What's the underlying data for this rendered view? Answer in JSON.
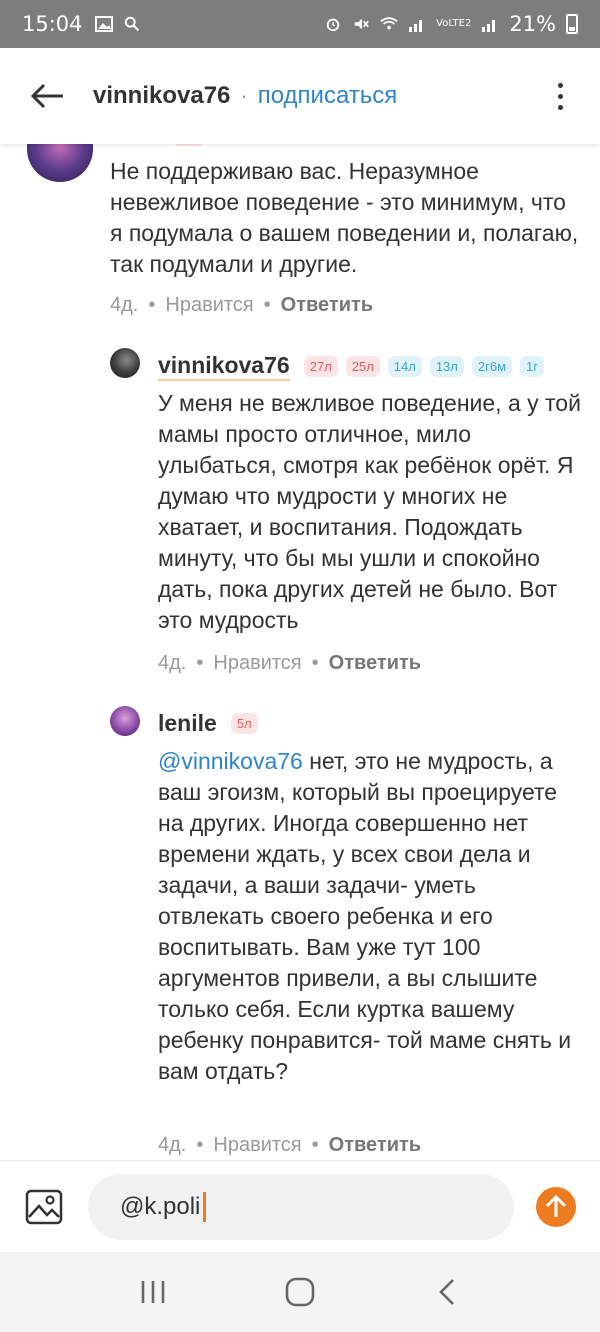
{
  "status_bar": {
    "time": "15:04",
    "battery": "21%",
    "network": "VoLTE2"
  },
  "header": {
    "username": "vinnikova76",
    "separator": "·",
    "subscribe_label": "подписаться"
  },
  "comments": [
    {
      "text": "Не поддерживаю вас. Неразумное невежливое поведение - это минимум, что я подумала о вашем поведении и, полагаю, так подумали и другие.",
      "time": "4д.",
      "like_label": "Нравится",
      "reply_label": "Ответить"
    },
    {
      "author": "vinnikova76",
      "badges": [
        "27л",
        "25л",
        "14л",
        "13л",
        "2г6м",
        "1г"
      ],
      "text": "У меня не вежливое поведение, а у той мамы просто отличное, мило улыбаться, смотря как ребёнок орёт. Я думаю что мудрости у многих не хватает, и воспитания. Подождать минуту, что бы мы ушли и спокойно дать, пока других детей не было. Вот это мудрость",
      "time": "4д.",
      "like_label": "Нравится",
      "reply_label": "Ответить"
    },
    {
      "author": "lenile",
      "badges": [
        "5л"
      ],
      "mention": "@vinnikova76",
      "text": " нет, это не мудрость, а ваш эгоизм, который вы проецируете на других. Иногда совершенно нет времени ждать, у всех свои дела и задачи, а ваши задачи- уметь отвлекать своего ребенка и его воспитывать. Вам уже тут 100 аргументов привели, а вы слышите только себя. Если куртка вашему ребенку понравится- той маме снять и вам отдать?",
      "time": "4д.",
      "like_label": "Нравится",
      "reply_label": "Ответить"
    }
  ],
  "input": {
    "value": "@k.poli"
  },
  "colors": {
    "accent": "#ee7b1f",
    "link": "#2d84c9",
    "status_bar": "#7d7d7d"
  },
  "icons": [
    "back-arrow-icon",
    "more-vertical-icon",
    "photo-icon",
    "send-arrow-icon",
    "recents-icon",
    "home-icon",
    "back-nav-icon"
  ]
}
